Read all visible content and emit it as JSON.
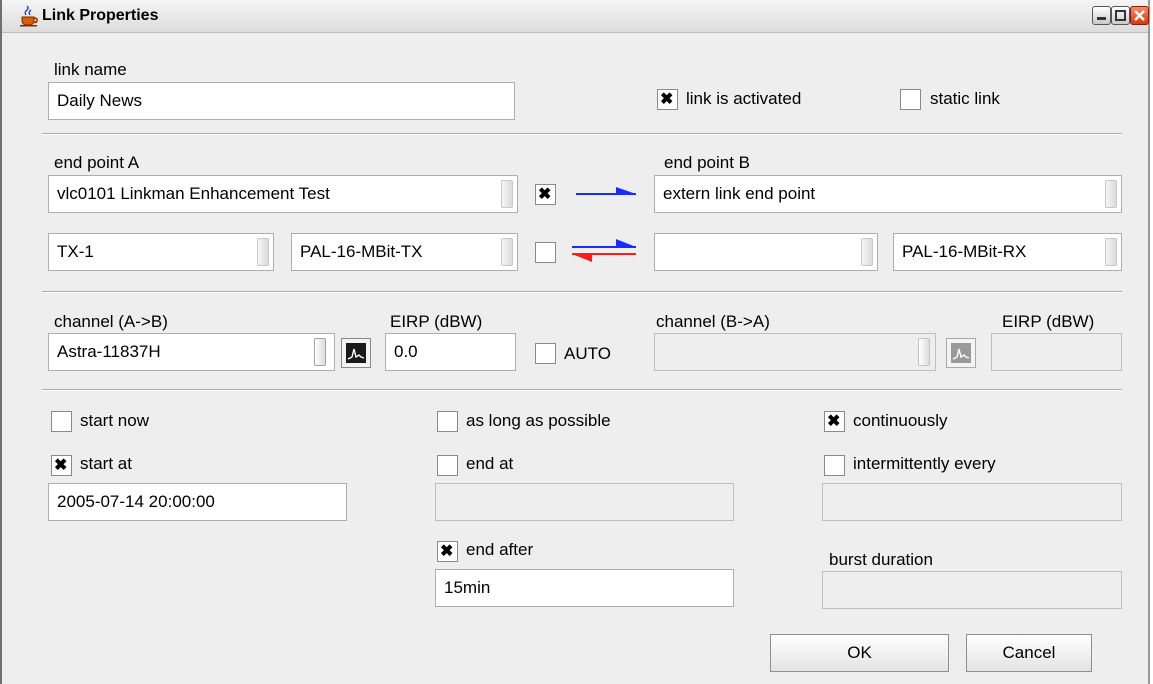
{
  "window": {
    "title": "Link Properties"
  },
  "link": {
    "name_label": "link name",
    "name_value": "Daily News",
    "activated_label": "link is activated",
    "activated_checked": true,
    "static_label": "static link",
    "static_checked": false
  },
  "endpoints": {
    "a_label": "end point A",
    "a_value": "vlc0101 Linkman Enhancement Test",
    "b_label": "end point B",
    "b_value": "extern link end point",
    "direction_one_way_checked": true,
    "direction_two_way_checked": false,
    "a_port": "TX-1",
    "a_profile": "PAL-16-MBit-TX",
    "b_port": "",
    "b_profile": "PAL-16-MBit-RX"
  },
  "channels": {
    "ab_label": "channel (A->B)",
    "ab_value": "Astra-11837H",
    "eirp_a_label": "EIRP (dBW)",
    "eirp_a_value": "0.0",
    "auto_label": "AUTO",
    "auto_checked": false,
    "ba_label": "channel (B->A)",
    "ba_value": "",
    "eirp_b_label": "EIRP (dBW)",
    "eirp_b_value": ""
  },
  "schedule": {
    "start_now_label": "start now",
    "start_now_checked": false,
    "start_at_label": "start at",
    "start_at_checked": true,
    "start_at_value": "2005-07-14 20:00:00",
    "as_long_label": "as long as possible",
    "as_long_checked": false,
    "end_at_label": "end at",
    "end_at_checked": false,
    "end_at_value": "",
    "end_after_label": "end after",
    "end_after_checked": true,
    "end_after_value": "15min",
    "continuously_label": "continuously",
    "continuously_checked": true,
    "intermittently_label": "intermittently every",
    "intermittently_checked": false,
    "intermittently_value": "",
    "burst_label": "burst duration",
    "burst_value": ""
  },
  "buttons": {
    "ok": "OK",
    "cancel": "Cancel"
  },
  "colors": {
    "arrow_blue": "#1a2bff",
    "arrow_red": "#ff1a1a"
  },
  "icons": [
    "java-cup-icon",
    "minimize-icon",
    "maximize-icon",
    "close-icon",
    "spectrum-graph-icon",
    "one-way-arrow-icon",
    "two-way-arrow-icon"
  ]
}
